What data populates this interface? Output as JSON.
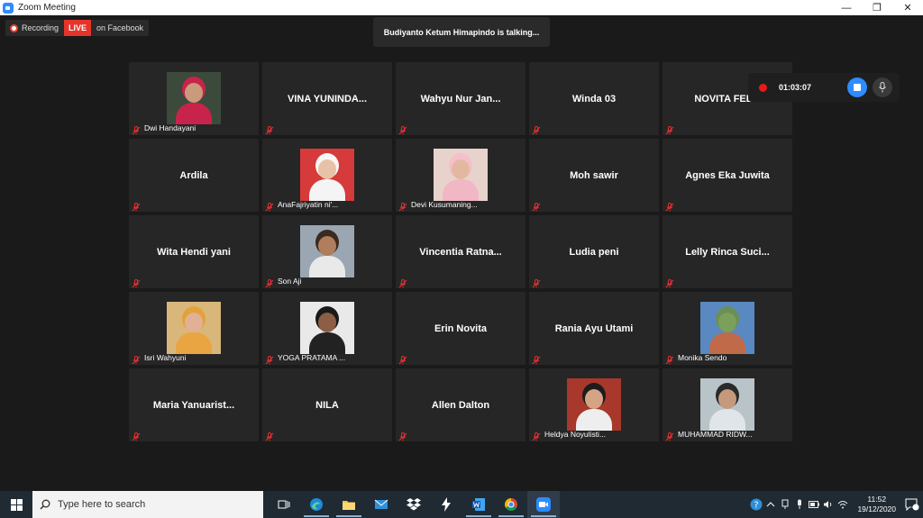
{
  "window": {
    "title": "Zoom Meeting",
    "controls": [
      "—",
      "❐",
      "✕"
    ]
  },
  "recording_status": {
    "recording_label": "Recording",
    "live_label": "LIVE",
    "stream_label": "on Facebook"
  },
  "talking_banner": "Budiyanto Ketum Himapindo is talking...",
  "record_widget": {
    "timer": "01:03:07"
  },
  "colors": {
    "accent": "#2d8cff",
    "live": "#e5352b",
    "record_dot": "#e8191a",
    "mute": "#e03030",
    "tile_bg": "#262626"
  },
  "participants": [
    {
      "name": "Dwi Handayani",
      "video": true,
      "bg": "#3b4a3a",
      "skin": "#c99a7c",
      "cloth": "#c8234a",
      "head": "#c8234a"
    },
    {
      "name": "VINA YUNINDA...",
      "video": false
    },
    {
      "name": "Wahyu Nur Jan...",
      "video": false
    },
    {
      "name": "Winda 03",
      "video": false
    },
    {
      "name": "NOVITA FEBR",
      "video": false
    },
    {
      "name": "Ardila",
      "video": false
    },
    {
      "name": "AnaFajriyatin ni'...",
      "video": true,
      "bg": "#d63a3a",
      "skin": "#e8c2a6",
      "cloth": "#f4f4f4",
      "head": "#f6f6f6"
    },
    {
      "name": "Devi Kusumaning...",
      "video": true,
      "bg": "#e7d3cb",
      "skin": "#e3b8a0",
      "cloth": "#f1b7c4",
      "head": "#f3c0cc"
    },
    {
      "name": "Moh sawir",
      "video": false
    },
    {
      "name": "Agnes Eka Juwita",
      "video": false
    },
    {
      "name": "Wita Hendi yani",
      "video": false
    },
    {
      "name": "Son Aji",
      "video": true,
      "bg": "#9aa7b3",
      "skin": "#b07d5d",
      "cloth": "#e9e9e9",
      "head": "#3a2a20"
    },
    {
      "name": "Vincentia  Ratna...",
      "video": false
    },
    {
      "name": "Ludia peni",
      "video": false
    },
    {
      "name": "Lelly  Rinca  Suci...",
      "video": false
    },
    {
      "name": "Isri Wahyuni",
      "video": true,
      "bg": "#d9b77a",
      "skin": "#e0b194",
      "cloth": "#e9a542",
      "head": "#e2a23a"
    },
    {
      "name": "YOGA PRATAMA ...",
      "video": true,
      "bg": "#e9e9e9",
      "skin": "#8b5e45",
      "cloth": "#222222",
      "head": "#1a1a1a"
    },
    {
      "name": "Erin Novita",
      "video": false
    },
    {
      "name": "Rania Ayu Utami",
      "video": false
    },
    {
      "name": "Monika Sendo",
      "video": true,
      "bg": "#5a89c2",
      "skin": "#7aa05c",
      "cloth": "#c06a4a",
      "head": "#6b8f55"
    },
    {
      "name": "Maria  Yanuarist...",
      "video": false
    },
    {
      "name": "NILA",
      "video": false
    },
    {
      "name": "Allen Dalton",
      "video": false
    },
    {
      "name": "Heldya Noyulisti...",
      "video": true,
      "bg": "#a8382b",
      "skin": "#d5a487",
      "cloth": "#eeeeee",
      "head": "#1c1c1c"
    },
    {
      "name": "MUHAMMAD RIDW...",
      "video": true,
      "bg": "#b9c4c9",
      "skin": "#c59a7c",
      "cloth": "#dfe5e8",
      "head": "#2a2a2a"
    }
  ],
  "taskbar": {
    "search_placeholder": "Type here to search",
    "time": "11:52",
    "date": "19/12/2020",
    "notification_count": "1"
  }
}
